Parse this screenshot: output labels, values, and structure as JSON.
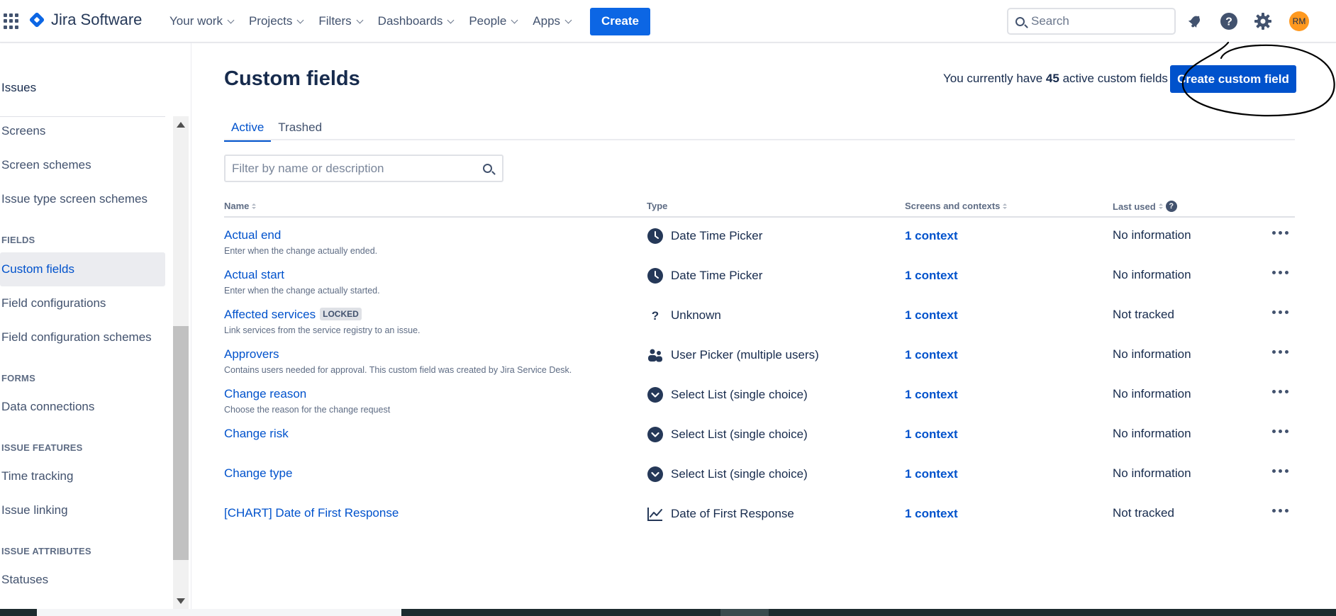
{
  "topnav": {
    "brand": "Jira Software",
    "items": [
      {
        "label": "Your work"
      },
      {
        "label": "Projects"
      },
      {
        "label": "Filters"
      },
      {
        "label": "Dashboards"
      },
      {
        "label": "People"
      },
      {
        "label": "Apps"
      }
    ],
    "create_label": "Create",
    "search_placeholder": "Search",
    "avatar_initials": "RM",
    "icons": [
      "app-switcher-icon",
      "notifications-icon",
      "help-icon",
      "settings-icon"
    ]
  },
  "sidebar": {
    "title": "Issues",
    "items": [
      {
        "label": "Screens"
      },
      {
        "label": "Screen schemes"
      },
      {
        "label": "Issue type screen schemes"
      }
    ],
    "fields_heading": "FIELDS",
    "fields_items": [
      {
        "label": "Custom fields"
      },
      {
        "label": "Field configurations"
      },
      {
        "label": "Field configuration schemes"
      }
    ],
    "forms_heading": "FORMS",
    "forms_items": [
      {
        "label": "Data connections"
      }
    ],
    "issue_features_heading": "ISSUE FEATURES",
    "issue_features_items": [
      {
        "label": "Time tracking"
      },
      {
        "label": "Issue linking"
      }
    ],
    "issue_attributes_heading": "ISSUE ATTRIBUTES",
    "issue_attributes_items": [
      {
        "label": "Statuses"
      }
    ]
  },
  "main": {
    "title": "Custom fields",
    "count_prefix": "You currently have",
    "count_value": "45",
    "count_suffix": "active custom fields",
    "create_button": "Create custom field",
    "tabs": [
      {
        "label": "Active"
      },
      {
        "label": "Trashed"
      }
    ],
    "filter_placeholder": "Filter by name or description",
    "columns": {
      "name": "Name",
      "type": "Type",
      "screens": "Screens and contexts",
      "last_used": "Last used"
    },
    "rows": [
      {
        "name": "Actual end",
        "locked": "",
        "desc": "Enter when the change actually ended.",
        "type": "Date Time Picker",
        "type_icon": "clock-icon",
        "contexts": "1 context",
        "last_used": "No information"
      },
      {
        "name": "Actual start",
        "locked": "",
        "desc": "Enter when the change actually started.",
        "type": "Date Time Picker",
        "type_icon": "clock-icon",
        "contexts": "1 context",
        "last_used": "No information"
      },
      {
        "name": "Affected services",
        "locked": "LOCKED",
        "desc": "Link services from the service registry to an issue.",
        "type": "Unknown",
        "type_icon": "question-icon",
        "contexts": "1 context",
        "last_used": "Not tracked"
      },
      {
        "name": "Approvers",
        "locked": "",
        "desc": "Contains users needed for approval. This custom field was created by Jira Service Desk.",
        "type": "User Picker (multiple users)",
        "type_icon": "users-icon",
        "contexts": "1 context",
        "last_used": "No information"
      },
      {
        "name": "Change reason",
        "locked": "",
        "desc": "Choose the reason for the change request",
        "type": "Select List (single choice)",
        "type_icon": "select-list-icon",
        "contexts": "1 context",
        "last_used": "No information"
      },
      {
        "name": "Change risk",
        "locked": "",
        "desc": "",
        "type": "Select List (single choice)",
        "type_icon": "select-list-icon",
        "contexts": "1 context",
        "last_used": "No information"
      },
      {
        "name": "Change type",
        "locked": "",
        "desc": "",
        "type": "Select List (single choice)",
        "type_icon": "select-list-icon",
        "contexts": "1 context",
        "last_used": "No information"
      },
      {
        "name": "[CHART] Date of First Response",
        "locked": "",
        "desc": "",
        "type": "Date of First Response",
        "type_icon": "chart-line-icon",
        "contexts": "1 context",
        "last_used": "Not tracked"
      }
    ]
  },
  "colors": {
    "brand_blue": "#0052cc",
    "text": "#172b4d",
    "subtle": "#5e6c84",
    "avatar": "#ff991f"
  }
}
